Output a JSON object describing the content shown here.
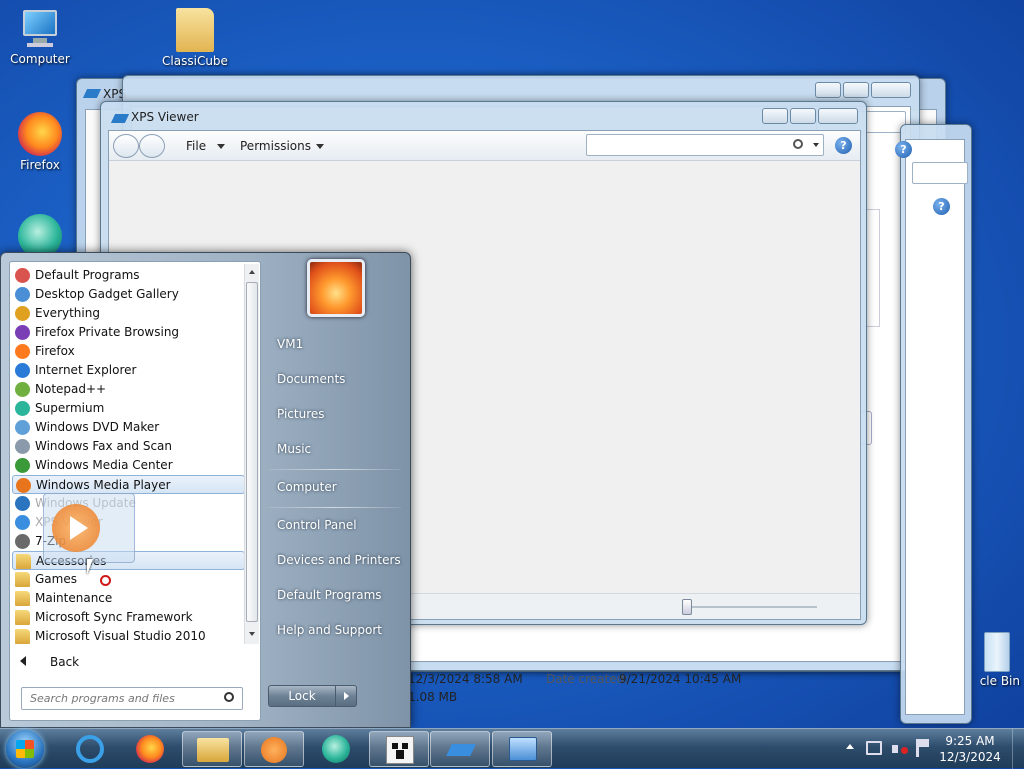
{
  "desktop": {
    "icons": [
      {
        "label": "Computer"
      },
      {
        "label": "ClassiCube"
      },
      {
        "label": "Firefox"
      },
      {
        "label": "cle Bin"
      }
    ]
  },
  "windows": {
    "back_title": "XPS",
    "front_title": "XPS Viewer",
    "menu_file": "File",
    "menu_permissions": "Permissions",
    "help": "?"
  },
  "details": {
    "modified": "12/3/2024 8:58 AM",
    "date_created_label": "Date created:",
    "date_created": "9/21/2024 10:45 AM",
    "size": "1.08 MB"
  },
  "start_menu": {
    "programs": [
      {
        "label": "Default Programs"
      },
      {
        "label": "Desktop Gadget Gallery"
      },
      {
        "label": "Everything"
      },
      {
        "label": "Firefox Private Browsing"
      },
      {
        "label": "Firefox"
      },
      {
        "label": "Internet Explorer"
      },
      {
        "label": "Notepad++"
      },
      {
        "label": "Supermium"
      },
      {
        "label": "Windows DVD Maker"
      },
      {
        "label": "Windows Fax and Scan"
      },
      {
        "label": "Windows Media Center"
      },
      {
        "label": "Windows Media Player"
      },
      {
        "label": "Windows Update"
      },
      {
        "label": "XPS Viewer"
      },
      {
        "label": "7-Zip"
      },
      {
        "label": "Accessories"
      },
      {
        "label": "Games"
      },
      {
        "label": "Maintenance"
      },
      {
        "label": "Microsoft Sync Framework"
      },
      {
        "label": "Microsoft Visual Studio 2010"
      }
    ],
    "back_label": "Back",
    "search_placeholder": "Search programs and files",
    "right_items": [
      {
        "label": "VM1"
      },
      {
        "label": "Documents"
      },
      {
        "label": "Pictures"
      },
      {
        "label": "Music"
      },
      {
        "label": "Computer"
      },
      {
        "label": "Control Panel"
      },
      {
        "label": "Devices and Printers"
      },
      {
        "label": "Default Programs"
      },
      {
        "label": "Help and Support"
      }
    ],
    "lock_label": "Lock"
  },
  "taskbar": {
    "clock_time": "9:25 AM",
    "clock_date": "12/3/2024"
  },
  "colors": {
    "accent": "#1f5fb0",
    "selection": "#d6e5f5"
  }
}
